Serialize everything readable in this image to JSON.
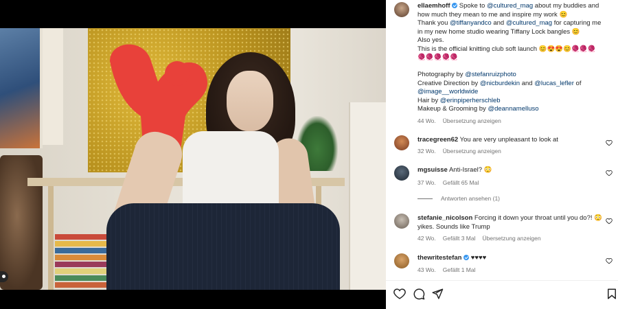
{
  "post": {
    "author": "ellaemhoff",
    "caption_line1": "Spoke to",
    "caption_mention1": "@cultured_mag",
    "caption_line1b": "about my buddies and how much they mean to me and inspire my work",
    "caption_thanks": "Thank you",
    "caption_mention2": "@tiffanyandco",
    "caption_and": "and",
    "caption_mention3": "@cultured_mag",
    "caption_thanks_b": "for capturing me in my new home studio wearing Tiffany Lock bangles",
    "caption_also": "Also yes.",
    "caption_knit": "This is the official knitting club soft launch",
    "credit_photo_label": "Photography by",
    "credit_photo_mention": "@stefanruizphoto",
    "credit_cd_label": "Creative Direction by",
    "credit_cd_mention1": "@nicburdekin",
    "credit_cd_and": "and",
    "credit_cd_mention2": "@lucas_lefler",
    "credit_cd_of": "of",
    "credit_cd_mention3": "@image__worldwide",
    "credit_hair_label": "Hair by",
    "credit_hair_mention": "@erinpiperherschleb",
    "credit_makeup_label": "Makeup & Grooming by",
    "credit_makeup_mention": "@deannamelluso",
    "age": "44 Wo.",
    "translate": "Übersetzung anzeigen"
  },
  "comments": [
    {
      "user": "tracegreen62",
      "text": "You are very unpleasant to look at",
      "age": "32 Wo.",
      "translate": "Übersetzung anzeigen",
      "likes": ""
    },
    {
      "user": "mgsuisse",
      "text": "Anti-Israel? 😳",
      "age": "37 Wo.",
      "likes": "Gefällt 65 Mal",
      "replies": "Antworten ansehen (1)"
    },
    {
      "user": "stefanie_nicolson",
      "text": "Forcing it down your throat until you do?! 😳 yikes. Sounds like Trump",
      "age": "42 Wo.",
      "likes": "Gefällt 3 Mal",
      "translate": "Übersetzung anzeigen"
    },
    {
      "user": "thewritestefan",
      "text": "♥♥♥♥",
      "age": "43 Wo.",
      "likes": "Gefällt 1 Mal"
    }
  ],
  "icons": {
    "like": "heart-icon",
    "comment": "comment-icon",
    "share": "paper-plane-icon",
    "save": "bookmark-icon"
  },
  "colors": {
    "link": "#00376b",
    "verified": "#3897f0",
    "muted": "#737373"
  }
}
